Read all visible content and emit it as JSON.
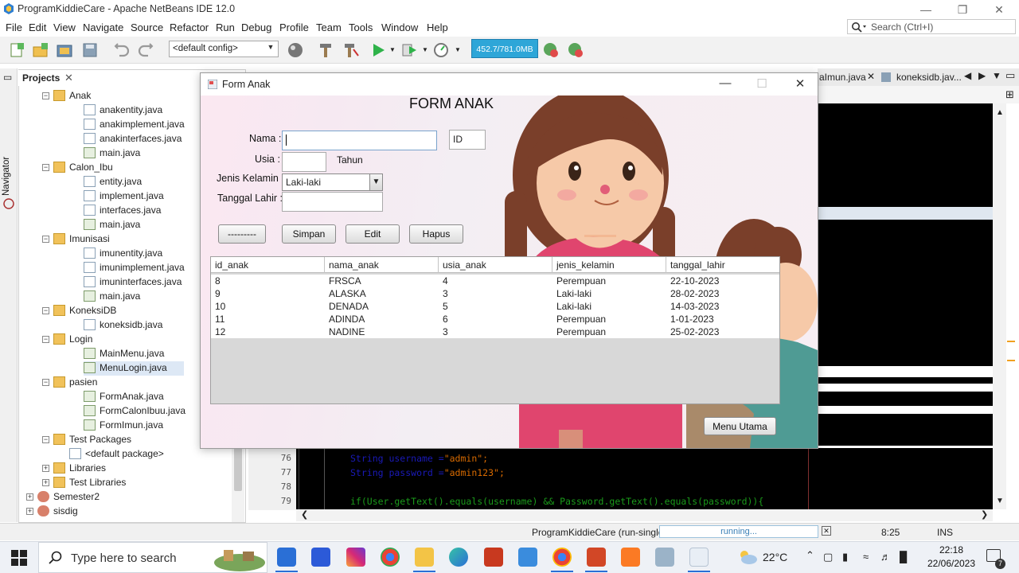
{
  "ide": {
    "title": "ProgramKiddieCare - Apache NetBeans IDE 12.0",
    "menu": [
      "File",
      "Edit",
      "View",
      "Navigate",
      "Source",
      "Refactor",
      "Run",
      "Debug",
      "Profile",
      "Team",
      "Tools",
      "Window",
      "Help"
    ],
    "search_placeholder": "Search (Ctrl+I)",
    "config": "<default config>",
    "memory": "452.7/781.0MB",
    "navigator_label": "Navigator",
    "projects_tab": "Projects",
    "editor_tabs": [
      "aImun.java",
      "koneksidb.jav..."
    ]
  },
  "tree": [
    {
      "label": "Anak",
      "type": "folder"
    },
    {
      "label": "anakentity.java",
      "type": "java"
    },
    {
      "label": "anakimplement.java",
      "type": "java"
    },
    {
      "label": "anakinterfaces.java",
      "type": "java"
    },
    {
      "label": "main.java",
      "type": "form"
    },
    {
      "label": "Calon_Ibu",
      "type": "folder"
    },
    {
      "label": "entity.java",
      "type": "java"
    },
    {
      "label": "implement.java",
      "type": "java"
    },
    {
      "label": "interfaces.java",
      "type": "java"
    },
    {
      "label": "main.java",
      "type": "form"
    },
    {
      "label": "Imunisasi",
      "type": "folder"
    },
    {
      "label": "imunentity.java",
      "type": "java"
    },
    {
      "label": "imunimplement.java",
      "type": "java"
    },
    {
      "label": "imuninterfaces.java",
      "type": "java"
    },
    {
      "label": "main.java",
      "type": "form"
    },
    {
      "label": "KoneksiDB",
      "type": "folder"
    },
    {
      "label": "koneksidb.java",
      "type": "java"
    },
    {
      "label": "Login",
      "type": "folder"
    },
    {
      "label": "MainMenu.java",
      "type": "form"
    },
    {
      "label": "MenuLogin.java",
      "type": "form"
    },
    {
      "label": "pasien",
      "type": "folder"
    },
    {
      "label": "FormAnak.java",
      "type": "form"
    },
    {
      "label": "FormCalonIbuu.java",
      "type": "form"
    },
    {
      "label": "FormImun.java",
      "type": "form"
    },
    {
      "label": "Test Packages",
      "type": "folder"
    },
    {
      "label": "<default package>",
      "type": "pkg"
    },
    {
      "label": "Libraries",
      "type": "lib"
    },
    {
      "label": "Test Libraries",
      "type": "lib"
    },
    {
      "label": "Semester2",
      "type": "cup"
    },
    {
      "label": "sisdig",
      "type": "cup"
    }
  ],
  "code": {
    "line_numbers": [
      "76",
      "77",
      "78",
      "79"
    ],
    "lines": [
      {
        "pre": "String username =",
        "str": "\"admin\";"
      },
      {
        "pre": "String password =",
        "str": "\"admin123\";"
      },
      {
        "pre": "",
        "str": ""
      },
      {
        "pre": "if(User.getText().equals(username) && Password.getText().equals(password)){",
        "str": ""
      }
    ]
  },
  "status": {
    "project": "ProgramKiddieCare (run-single)",
    "progress": "running...",
    "position": "8:25",
    "mode": "INS"
  },
  "form": {
    "window_title": "Form Anak",
    "heading": "FORM ANAK",
    "labels": {
      "nama": "Nama :",
      "usia": "Usia :",
      "tahun": "Tahun",
      "jenis_kelamin": "Jenis Kelamin :",
      "tanggal_lahir": "Tanggal Lahir :"
    },
    "id_field": "ID",
    "jenis_kelamin_value": "Laki-laki",
    "buttons": {
      "clear": "---------",
      "simpan": "Simpan",
      "edit": "Edit",
      "hapus": "Hapus",
      "menu_utama": "Menu Utama"
    },
    "table": {
      "columns": [
        "id_anak",
        "nama_anak",
        "usia_anak",
        "jenis_kelamin",
        "tanggal_lahir"
      ],
      "rows": [
        [
          "8",
          "FRSCA",
          "4",
          "Perempuan",
          "22-10-2023"
        ],
        [
          "9",
          "ALASKA",
          "3",
          "Laki-laki",
          "28-02-2023"
        ],
        [
          "10",
          "DENADA",
          "5",
          "Laki-laki",
          "14-03-2023"
        ],
        [
          "11",
          "ADINDA",
          "6",
          "Perempuan",
          "1-01-2023"
        ],
        [
          "12",
          "NADINE",
          "3",
          "Perempuan",
          "25-02-2023"
        ]
      ]
    }
  },
  "taskbar": {
    "search_placeholder": "Type here to search",
    "temperature": "22°C",
    "time": "22:18",
    "date": "22/06/2023",
    "notifications": "7"
  }
}
